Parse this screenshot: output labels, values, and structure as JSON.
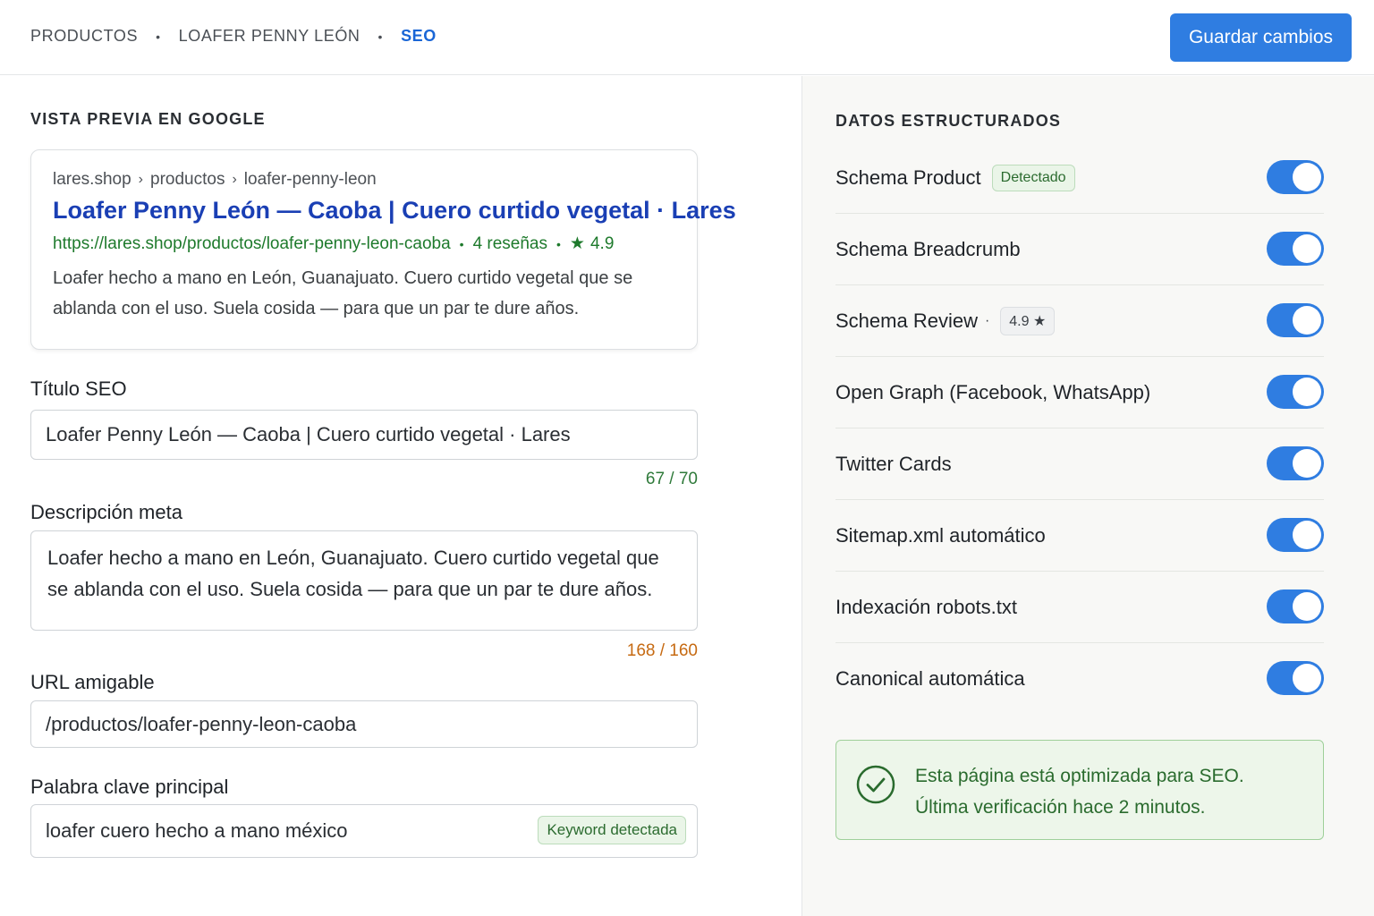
{
  "breadcrumb": {
    "items": [
      "PRODUCTOS",
      "LOAFER PENNY LEÓN",
      "SEO"
    ],
    "separator": "•"
  },
  "header": {
    "save_label": "Guardar cambios"
  },
  "preview": {
    "section_title": "VISTA PREVIA EN GOOGLE",
    "path": [
      "lares.shop",
      "productos",
      "loafer-penny-leon"
    ],
    "path_separator": "›",
    "title": "Loafer Penny León — Caoba | Cuero curtido vegetal · Lares",
    "url": "https://lares.shop/productos/loafer-penny-leon-caoba",
    "reviews": "4 reseñas",
    "rating": "4.9",
    "dot": "•",
    "description": "Loafer hecho a mano en León, Guanajuato. Cuero curtido vegetal que se ablanda con el uso. Suela cosida — para que un par te dure años."
  },
  "form": {
    "seo_title": {
      "label": "Título SEO",
      "value": "Loafer Penny León — Caoba | Cuero curtido vegetal · Lares",
      "counter": "67 / 70"
    },
    "meta_description": {
      "label": "Descripción meta",
      "value": "Loafer hecho a mano en León, Guanajuato. Cuero curtido vegetal que se ablanda con el uso. Suela cosida — para que un par te dure años.",
      "counter": "168 / 160"
    },
    "friendly_url": {
      "label": "URL amigable",
      "value": "/productos/loafer-penny-leon-caoba"
    },
    "keyword": {
      "label": "Palabra clave principal",
      "value": "loafer cuero hecho a mano méxico",
      "badge": "Keyword detectada"
    }
  },
  "structured_data": {
    "section_title": "DATOS ESTRUCTURADOS",
    "items": [
      {
        "label": "Schema Product",
        "badge": "Detectado",
        "enabled": true
      },
      {
        "label": "Schema Breadcrumb",
        "enabled": true
      },
      {
        "label": "Schema Review",
        "badge": "4.9 ★",
        "enabled": true
      },
      {
        "label": "Open Graph (Facebook, WhatsApp)",
        "enabled": true
      },
      {
        "label": "Twitter Cards",
        "enabled": true
      },
      {
        "label": "Sitemap.xml automático",
        "enabled": true
      },
      {
        "label": "Indexación robots.txt",
        "enabled": true
      },
      {
        "label": "Canonical automática",
        "enabled": true
      }
    ],
    "review_separator": "·"
  },
  "status": {
    "line1": "Esta página está optimizada para SEO.",
    "line2": "Última verificación hace 2 minutos."
  },
  "colors": {
    "primary": "#2f7de1",
    "success": "#2b6b2f",
    "warning": "#c66a12",
    "link": "#1a3fb4"
  },
  "icons": {
    "star": "star-icon",
    "check": "check-circle-icon"
  }
}
